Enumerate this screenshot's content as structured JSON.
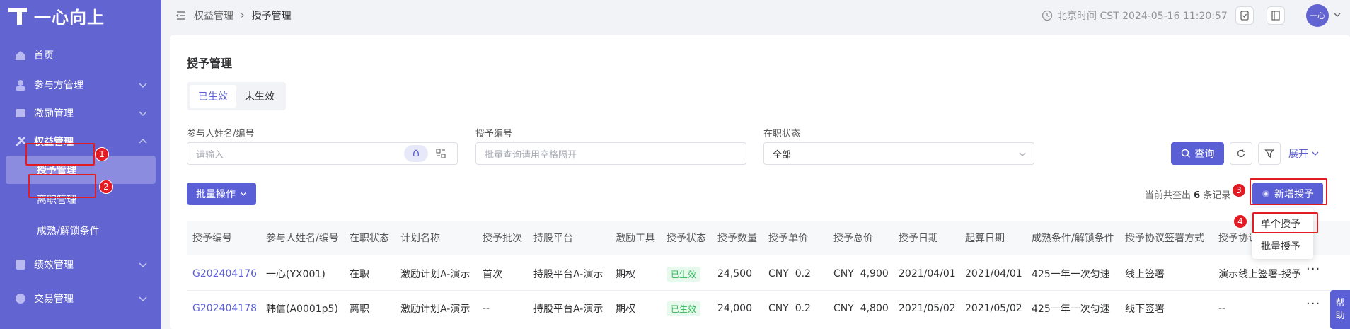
{
  "brand": {
    "name": "一心向上"
  },
  "sidebar": {
    "items": [
      {
        "label": "首页",
        "icon": "home-icon"
      },
      {
        "label": "参与方管理",
        "icon": "people-icon"
      },
      {
        "label": "激励管理",
        "icon": "incentive-icon"
      },
      {
        "label": "权益管理",
        "icon": "equity-icon",
        "active": true
      },
      {
        "label": "授予管理",
        "sub": true,
        "selected": true
      },
      {
        "label": "离职管理",
        "sub": true
      },
      {
        "label": "成熟/解锁条件",
        "sub": true
      },
      {
        "label": "绩效管理",
        "icon": "performance-icon"
      },
      {
        "label": "交易管理",
        "icon": "trade-icon"
      }
    ]
  },
  "topbar": {
    "breadcrumb": [
      "权益管理",
      "授予管理"
    ],
    "clock": "北京时间 CST 2024-05-16 11:20:57",
    "user": "一心"
  },
  "page": {
    "title": "授予管理",
    "tabs": [
      {
        "label": "已生效",
        "active": true
      },
      {
        "label": "未生效"
      }
    ]
  },
  "filters": {
    "participant": {
      "label": "参与人姓名/编号",
      "placeholder": "请输入"
    },
    "grant_no": {
      "label": "授予编号",
      "placeholder": "批量查询请用空格隔开"
    },
    "status": {
      "label": "在职状态",
      "value": "全部"
    },
    "search_label": "查询",
    "expand_label": "展开"
  },
  "toolbar": {
    "batch_label": "批量操作",
    "result_prefix": "当前共查出",
    "result_count": "6",
    "result_suffix": "条记录",
    "new_grant_label": "新增授予"
  },
  "dropdown": {
    "items": [
      "单个授予",
      "批量授予"
    ]
  },
  "table": {
    "columns": [
      "授予编号",
      "参与人姓名/编号",
      "在职状态",
      "计划名称",
      "授予批次",
      "持股平台",
      "激励工具",
      "授予状态",
      "授予数量",
      "授予单价",
      "授予总价",
      "授予日期",
      "起算日期",
      "成熟条件/解锁条件",
      "授予协议签署方式",
      "授予协议"
    ],
    "rows": [
      [
        "G202404176",
        "一心(YX001)",
        "在职",
        "激励计划A-演示",
        "首次",
        "持股平台A-演示",
        "期权",
        "已生效",
        "24,500",
        "CNY  0.2",
        "CNY  4,900",
        "2021/04/01",
        "2021/04/01",
        "425一年一次匀速",
        "线上签署",
        "演示线上签署-授予"
      ],
      [
        "G202404178",
        "韩信(A0001p5)",
        "离职",
        "激励计划A-演示",
        "--",
        "持股平台A-演示",
        "期权",
        "已生效",
        "24,000",
        "CNY  0.2",
        "CNY  4,800",
        "2021/05/02",
        "2021/05/02",
        "425一年一次匀速",
        "线下签署",
        "--"
      ]
    ]
  },
  "annotations": [
    "1",
    "2",
    "3",
    "4"
  ],
  "help": {
    "label1": "帮",
    "label2": "助"
  },
  "colors": {
    "sidebar": "#6264d2",
    "primary": "#5b5fd6",
    "annotation": "#e31b23",
    "tag_green": "#2fb657"
  }
}
